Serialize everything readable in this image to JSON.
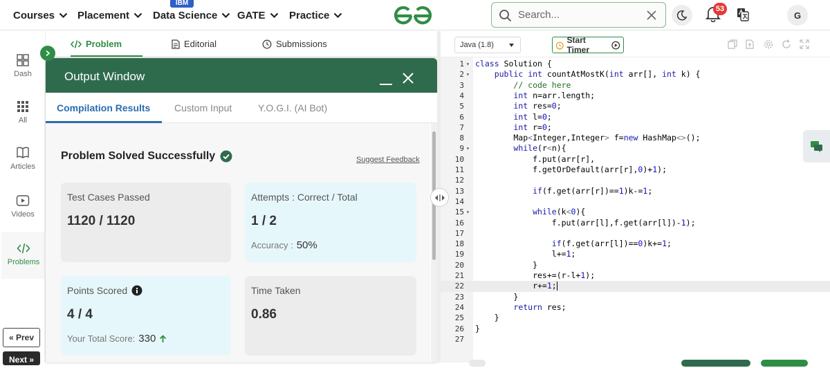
{
  "topnav": {
    "items": [
      "Courses",
      "Placement",
      "Data Science",
      "GATE",
      "Practice"
    ],
    "badge": "IBM",
    "search_placeholder": "Search...",
    "notification_count": "53",
    "avatar_letter": "G"
  },
  "sidebar": {
    "items": [
      "Dash",
      "All",
      "Articles",
      "Videos",
      "Problems"
    ],
    "prev": "« Prev",
    "next": "Next »"
  },
  "problem_tabs": [
    "Problem",
    "Editorial",
    "Submissions"
  ],
  "output_window": {
    "title": "Output Window",
    "tabs": [
      "Compilation Results",
      "Custom Input",
      "Y.O.G.I. (AI Bot)"
    ],
    "status": "Problem Solved Successfully",
    "suggest_feedback": "Suggest Feedback",
    "cards": {
      "test_cases_label": "Test Cases Passed",
      "test_cases_value": "1120 / 1120",
      "attempts_label": "Attempts : Correct / Total",
      "attempts_value": "1 / 2",
      "accuracy_label": "Accuracy :",
      "accuracy_value": "50%",
      "points_label": "Points Scored",
      "points_value": "4 / 4",
      "total_score_label": "Your Total Score:",
      "total_score_value": "330",
      "time_label": "Time Taken",
      "time_value": "0.86"
    }
  },
  "editor": {
    "language": "Java (1.8)",
    "timer_label": "Start Timer",
    "lines": [
      "class Solution {",
      "    public int countAtMostK(int arr[], int k) {",
      "        // code here",
      "        int n=arr.length;",
      "        int res=0;",
      "        int l=0;",
      "        int r=0;",
      "        Map<Integer,Integer> f=new HashMap<>();",
      "        while(r<n){",
      "            f.put(arr[r],",
      "            f.getOrDefault(arr[r],0)+1);",
      "",
      "            if(f.get(arr[r])==1)k-=1;",
      "",
      "            while(k<0){",
      "                f.put(arr[l],f.get(arr[l])-1);",
      "",
      "                if(f.get(arr[l])==0)k+=1;",
      "                l+=1;",
      "            }",
      "            res+=(r-l+1);",
      "            r+=1;",
      "        }",
      "        return res;",
      "    }",
      "}",
      ""
    ],
    "line_numbers": [
      "1",
      "2",
      "3",
      "4",
      "5",
      "6",
      "7",
      "8",
      "9",
      "10",
      "11",
      "12",
      "13",
      "14",
      "15",
      "16",
      "17",
      "18",
      "19",
      "20",
      "21",
      "22",
      "23",
      "24",
      "25",
      "26",
      "27"
    ],
    "fold_lines": [
      1,
      2,
      9,
      15
    ],
    "active_line": 22
  },
  "colors": {
    "brand_green": "#2f8d46",
    "header_green": "#2e6b4d",
    "link_blue": "#2a6db0",
    "keyword": "#1a1aa6",
    "comment": "#236e25"
  }
}
